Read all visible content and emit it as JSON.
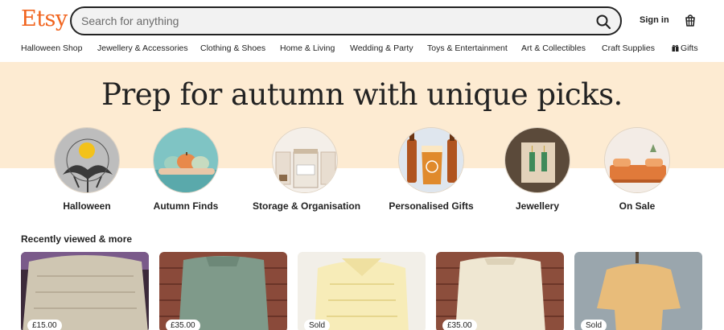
{
  "header": {
    "logo": "Etsy",
    "search_placeholder": "Search for anything",
    "sign_in": "Sign in",
    "search_icon": "search-icon",
    "cart_icon": "cart-icon"
  },
  "nav": {
    "items": [
      "Halloween Shop",
      "Jewellery & Accessories",
      "Clothing & Shoes",
      "Home & Living",
      "Wedding & Party",
      "Toys & Entertainment",
      "Art & Collectibles",
      "Craft Supplies",
      "Gifts"
    ],
    "gift_icon": "gift-icon"
  },
  "hero": {
    "title": "Prep for autumn with unique picks.",
    "background": "#fdebd2"
  },
  "categories": [
    {
      "label": "Halloween"
    },
    {
      "label": "Autumn Finds"
    },
    {
      "label": "Storage & Organisation"
    },
    {
      "label": "Personalised Gifts"
    },
    {
      "label": "Jewellery"
    },
    {
      "label": "On Sale"
    }
  ],
  "recently_viewed": {
    "title": "Recently viewed & more",
    "items": [
      {
        "badge": "£15.00"
      },
      {
        "badge": "£35.00"
      },
      {
        "badge": "Sold"
      },
      {
        "badge": "£35.00"
      },
      {
        "badge": "Sold"
      }
    ]
  },
  "colors": {
    "brand": "#f1641e",
    "hero_bg": "#fdebd2"
  }
}
